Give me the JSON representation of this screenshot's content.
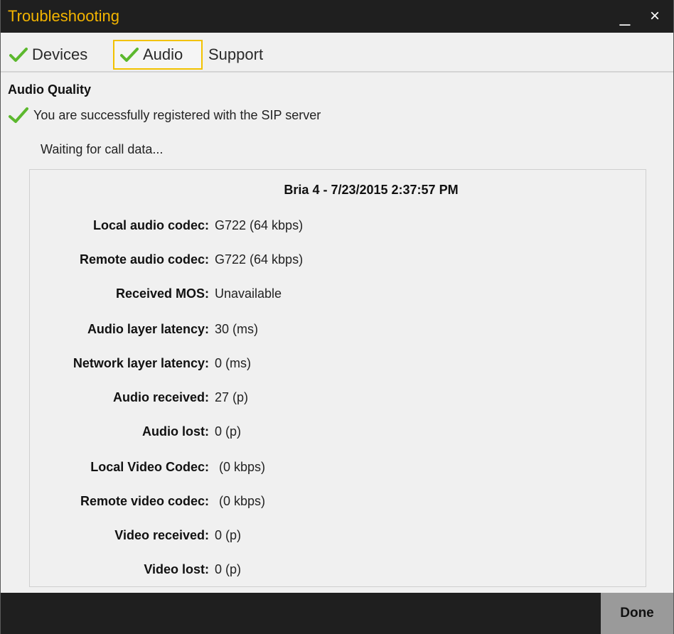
{
  "window": {
    "title": "Troubleshooting",
    "minimize_glyph": "_",
    "close_glyph": "×"
  },
  "tabs": [
    {
      "label": "Devices",
      "checked": true,
      "active": false
    },
    {
      "label": "Audio",
      "checked": true,
      "active": true
    },
    {
      "label": "Support",
      "checked": false,
      "active": false
    }
  ],
  "audio_quality": {
    "heading": "Audio Quality",
    "status": "You are successfully registered with the SIP server",
    "waiting": "Waiting for call data..."
  },
  "call_panel": {
    "title": "Bria 4 - 7/23/2015 2:37:57 PM",
    "rows": [
      {
        "label": "Local audio codec:",
        "value": "G722 (64 kbps)"
      },
      {
        "label": "Remote audio codec:",
        "value": "G722 (64 kbps)"
      },
      {
        "label": "Received MOS:",
        "value": "Unavailable"
      },
      {
        "label": "Audio layer latency:",
        "value": "30 (ms)"
      },
      {
        "label": "Network layer latency:",
        "value": "0 (ms)"
      },
      {
        "label": "Audio received:",
        "value": "27 (p)"
      },
      {
        "label": "Audio lost:",
        "value": "0 (p)"
      },
      {
        "label": "Local Video Codec:",
        "value": "(0 kbps)"
      },
      {
        "label": "Remote video codec:",
        "value": "(0 kbps)"
      },
      {
        "label": "Video received:",
        "value": "0 (p)"
      },
      {
        "label": "Video lost:",
        "value": "0 (p)"
      }
    ]
  },
  "footer": {
    "done_label": "Done"
  },
  "colors": {
    "title_accent": "#f3b400",
    "active_tab_border": "#f2c200",
    "check_green": "#5cb82e",
    "titlebar_bg": "#1f1f1f"
  },
  "icons": {
    "tab_check": "checkmark-icon",
    "status_check": "checkmark-icon",
    "minimize": "minimize-icon",
    "close": "close-icon"
  }
}
